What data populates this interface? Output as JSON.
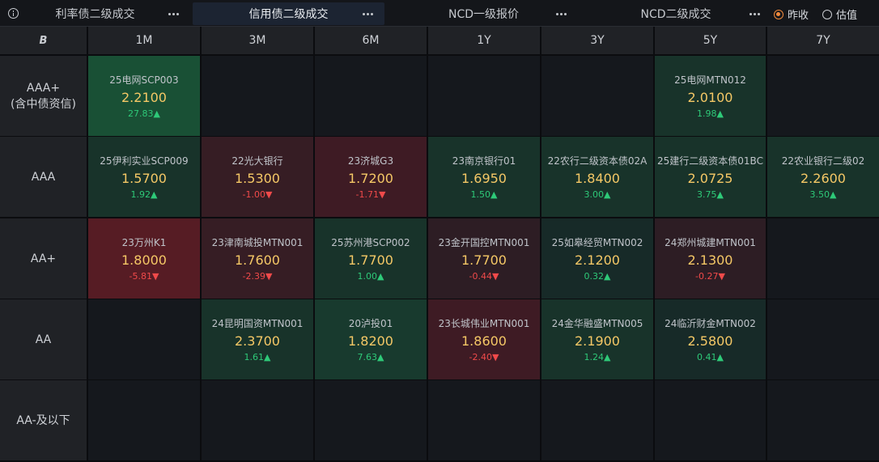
{
  "tabs": [
    {
      "label": "利率债二级成交",
      "active": false
    },
    {
      "label": "信用债二级成交",
      "active": true
    },
    {
      "label": "NCD一级报价",
      "active": false
    },
    {
      "label": "NCD二级成交",
      "active": false
    }
  ],
  "radio": [
    {
      "label": "昨收",
      "checked": true
    },
    {
      "label": "估值",
      "checked": false
    }
  ],
  "corner_icon": "B",
  "columns": [
    "1M",
    "3M",
    "6M",
    "1Y",
    "3Y",
    "5Y",
    "7Y"
  ],
  "rows": [
    {
      "label": "AAA+",
      "sublabel": "(含中债资信)"
    },
    {
      "label": "AAA",
      "sublabel": ""
    },
    {
      "label": "AA+",
      "sublabel": ""
    },
    {
      "label": "AA",
      "sublabel": ""
    },
    {
      "label": "AA-及以下",
      "sublabel": ""
    }
  ],
  "cells": [
    [
      {
        "name": "25电网SCP003",
        "value": "2.2100",
        "change": "27.83",
        "dir": "up",
        "bg": "#195035"
      },
      null,
      null,
      null,
      null,
      {
        "name": "25电网MTN012",
        "value": "2.0100",
        "change": "1.98",
        "dir": "up",
        "bg": "#18332a"
      },
      null
    ],
    [
      {
        "name": "25伊利实业SCP009",
        "value": "1.5700",
        "change": "1.92",
        "dir": "up",
        "bg": "#18332a"
      },
      {
        "name": "22光大银行",
        "value": "1.5300",
        "change": "-1.00",
        "dir": "down",
        "bg": "#361d24"
      },
      {
        "name": "23济城G3",
        "value": "1.7200",
        "change": "-1.71",
        "dir": "down",
        "bg": "#3e1b24"
      },
      {
        "name": "23南京银行01",
        "value": "1.6950",
        "change": "1.50",
        "dir": "up",
        "bg": "#18332a"
      },
      {
        "name": "22农行二级资本债02A",
        "value": "1.8400",
        "change": "3.00",
        "dir": "up",
        "bg": "#18332a"
      },
      {
        "name": "25建行二级资本债01BC",
        "value": "2.0725",
        "change": "3.75",
        "dir": "up",
        "bg": "#18332a"
      },
      {
        "name": "22农业银行二级02",
        "value": "2.2600",
        "change": "3.50",
        "dir": "up",
        "bg": "#18332a"
      }
    ],
    [
      {
        "name": "23万州K1",
        "value": "1.8000",
        "change": "-5.81",
        "dir": "down",
        "bg": "#561c24"
      },
      {
        "name": "23津南城投MTN001",
        "value": "1.7600",
        "change": "-2.39",
        "dir": "down",
        "bg": "#361d24"
      },
      {
        "name": "25苏州港SCP002",
        "value": "1.7700",
        "change": "1.00",
        "dir": "up",
        "bg": "#18332a"
      },
      {
        "name": "23金开国控MTN001",
        "value": "1.7700",
        "change": "-0.44",
        "dir": "down",
        "bg": "#2d1d24"
      },
      {
        "name": "25如皋经贸MTN002",
        "value": "2.1200",
        "change": "0.32",
        "dir": "up",
        "bg": "#172a28"
      },
      {
        "name": "24郑州城建MTN001",
        "value": "2.1300",
        "change": "-0.27",
        "dir": "down",
        "bg": "#2d1d24"
      },
      null
    ],
    [
      null,
      {
        "name": "24昆明国资MTN001",
        "value": "2.3700",
        "change": "1.61",
        "dir": "up",
        "bg": "#18332a"
      },
      {
        "name": "20泸投01",
        "value": "1.8200",
        "change": "7.63",
        "dir": "up",
        "bg": "#183a2e"
      },
      {
        "name": "23长城伟业MTN001",
        "value": "1.8600",
        "change": "-2.40",
        "dir": "down",
        "bg": "#3e1b24"
      },
      {
        "name": "24金华融盛MTN005",
        "value": "2.1900",
        "change": "1.24",
        "dir": "up",
        "bg": "#18332a"
      },
      {
        "name": "24临沂财金MTN002",
        "value": "2.5800",
        "change": "0.41",
        "dir": "up",
        "bg": "#172a28"
      },
      null
    ],
    [
      null,
      null,
      null,
      null,
      null,
      null,
      null
    ]
  ]
}
